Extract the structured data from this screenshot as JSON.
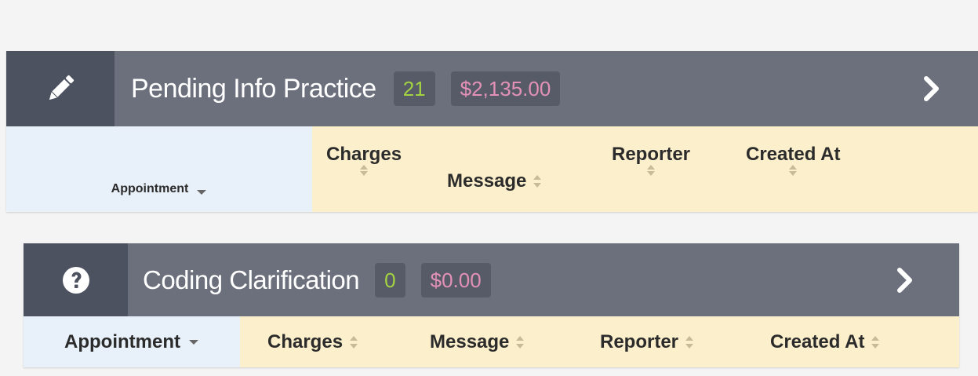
{
  "panels": [
    {
      "title": "Pending Info Practice",
      "count": "21",
      "amount": "$2,135.00",
      "icon": "pencil-icon",
      "columns": {
        "appointment": "Appointment",
        "charges": "Charges",
        "message": "Message",
        "reporter": "Reporter",
        "created_at": "Created At"
      }
    },
    {
      "title": "Coding Clarification",
      "count": "0",
      "amount": "$0.00",
      "icon": "question-circle-icon",
      "columns": {
        "appointment": "Appointment",
        "charges": "Charges",
        "message": "Message",
        "reporter": "Reporter",
        "created_at": "Created At"
      }
    }
  ],
  "colors": {
    "header_bg": "#6b707c",
    "icon_box_bg": "#4d5260",
    "badge_bg": "#565b67",
    "count_color": "#a4d341",
    "amount_color": "#e391b6",
    "table_header_bg": "#fcefcb",
    "sorted_column_bg": "#e8f0f9"
  }
}
